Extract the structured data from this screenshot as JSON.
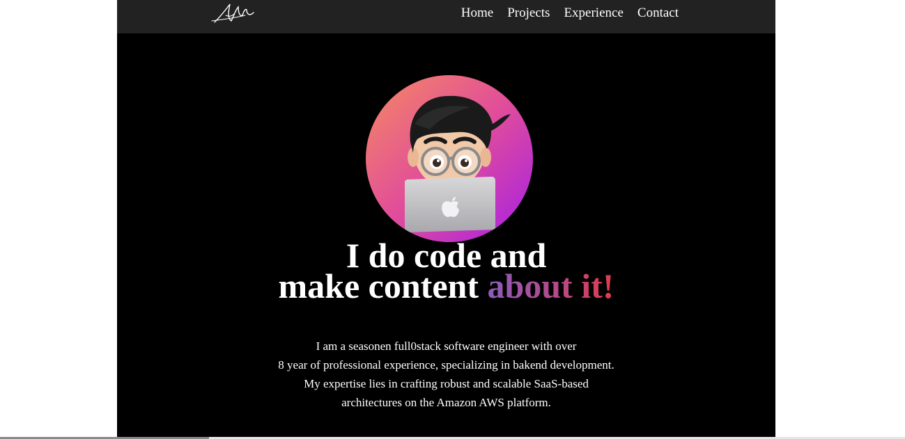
{
  "nav": {
    "logo_icon": "signature-logo",
    "links": [
      "Home",
      "Projects",
      "Experience",
      "Contact"
    ]
  },
  "hero": {
    "avatar_icon": "memoji-avatar-with-laptop",
    "headline_line1": "I do code and",
    "headline_line2": "make content ",
    "headline_accent": "about it!",
    "bio_lines": [
      "I am a seasonen full0stack software engineer with over",
      "8 year of professional experience, specializing in bakend development.",
      "My expertise lies in crafting robust and scalable SaaS-based",
      "architectures on the Amazon AWS platform."
    ]
  },
  "colors": {
    "page_bg": "#000000",
    "nav_bg": "#222222",
    "accent_start": "#8b5cb8",
    "accent_end": "#e33b4a",
    "avatar_gradient_start": "#f47a6f",
    "avatar_gradient_end": "#b224e0"
  }
}
